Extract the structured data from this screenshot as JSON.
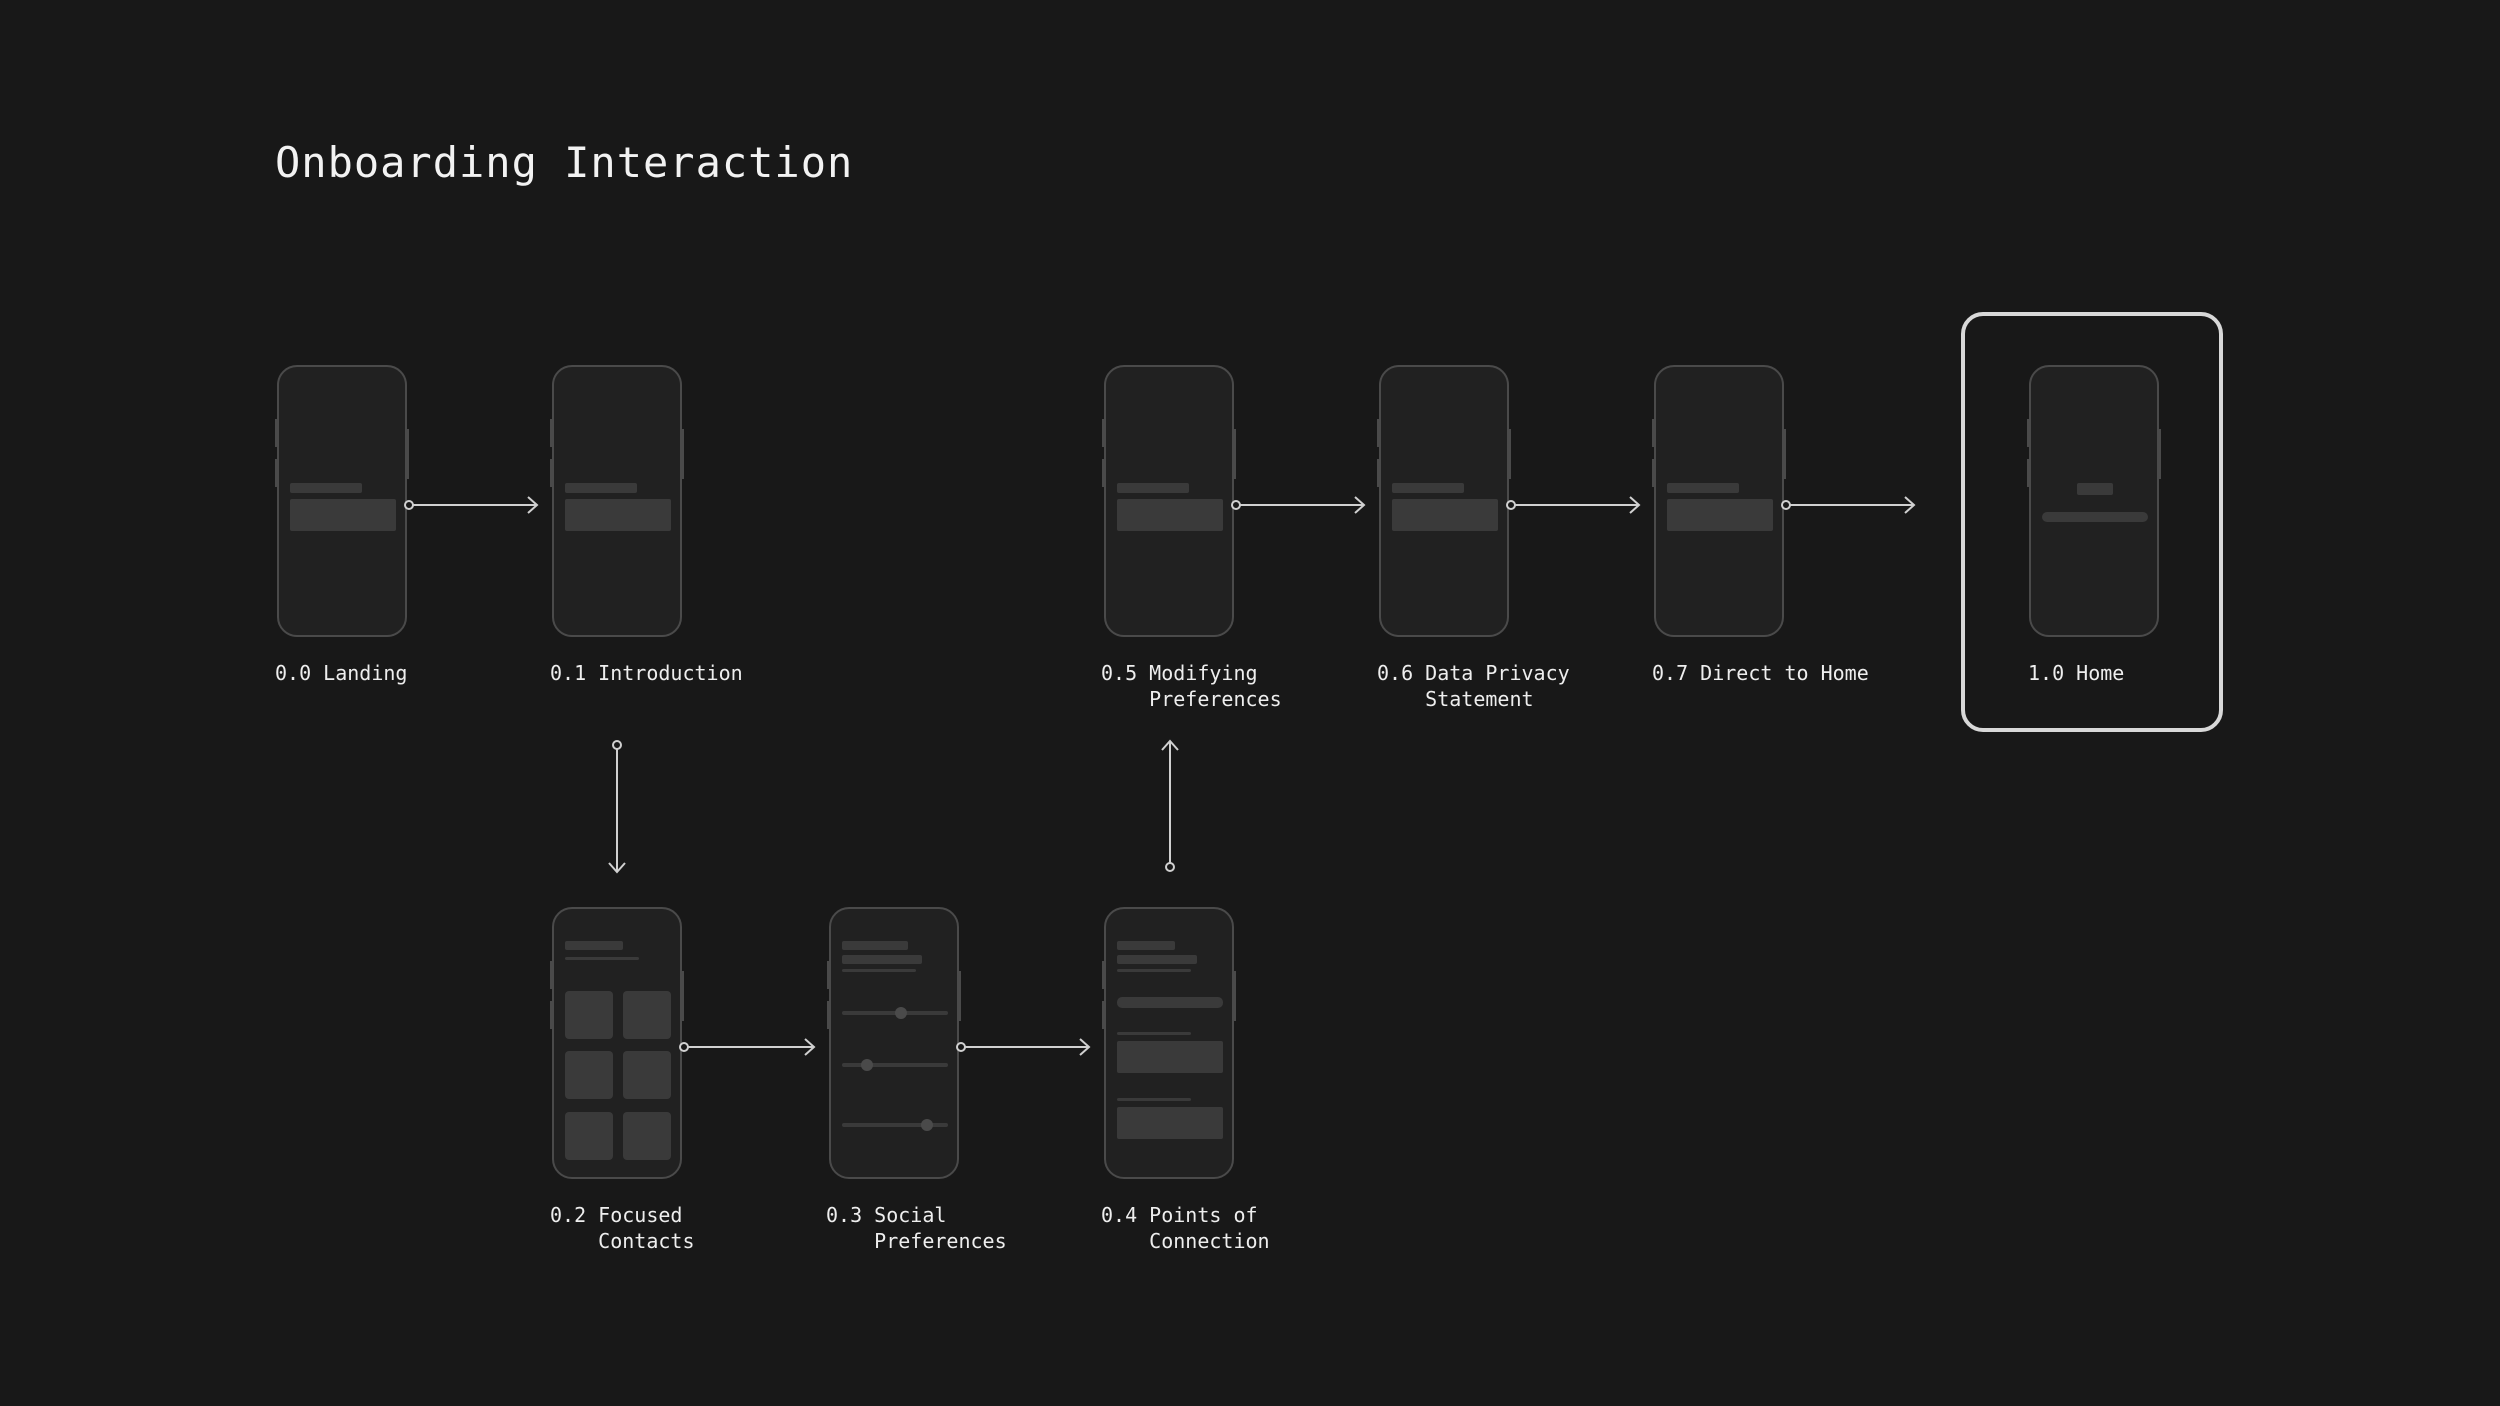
{
  "title": "Onboarding Interaction",
  "screens": [
    {
      "id": "0.0",
      "name": "Landing"
    },
    {
      "id": "0.1",
      "name": "Introduction"
    },
    {
      "id": "0.2",
      "name": "Focused\nContacts"
    },
    {
      "id": "0.3",
      "name": "Social\nPreferences"
    },
    {
      "id": "0.4",
      "name": "Points of\nConnection"
    },
    {
      "id": "0.5",
      "name": "Modifying\nPreferences"
    },
    {
      "id": "0.6",
      "name": "Data Privacy\nStatement"
    },
    {
      "id": "0.7",
      "name": "Direct to Home"
    },
    {
      "id": "1.0",
      "name": "Home"
    }
  ],
  "colors": {
    "background": "#181818",
    "phone_stroke": "#4a4a4a",
    "arrow": "#d0d0d0",
    "highlight": "#d8d8d8"
  }
}
